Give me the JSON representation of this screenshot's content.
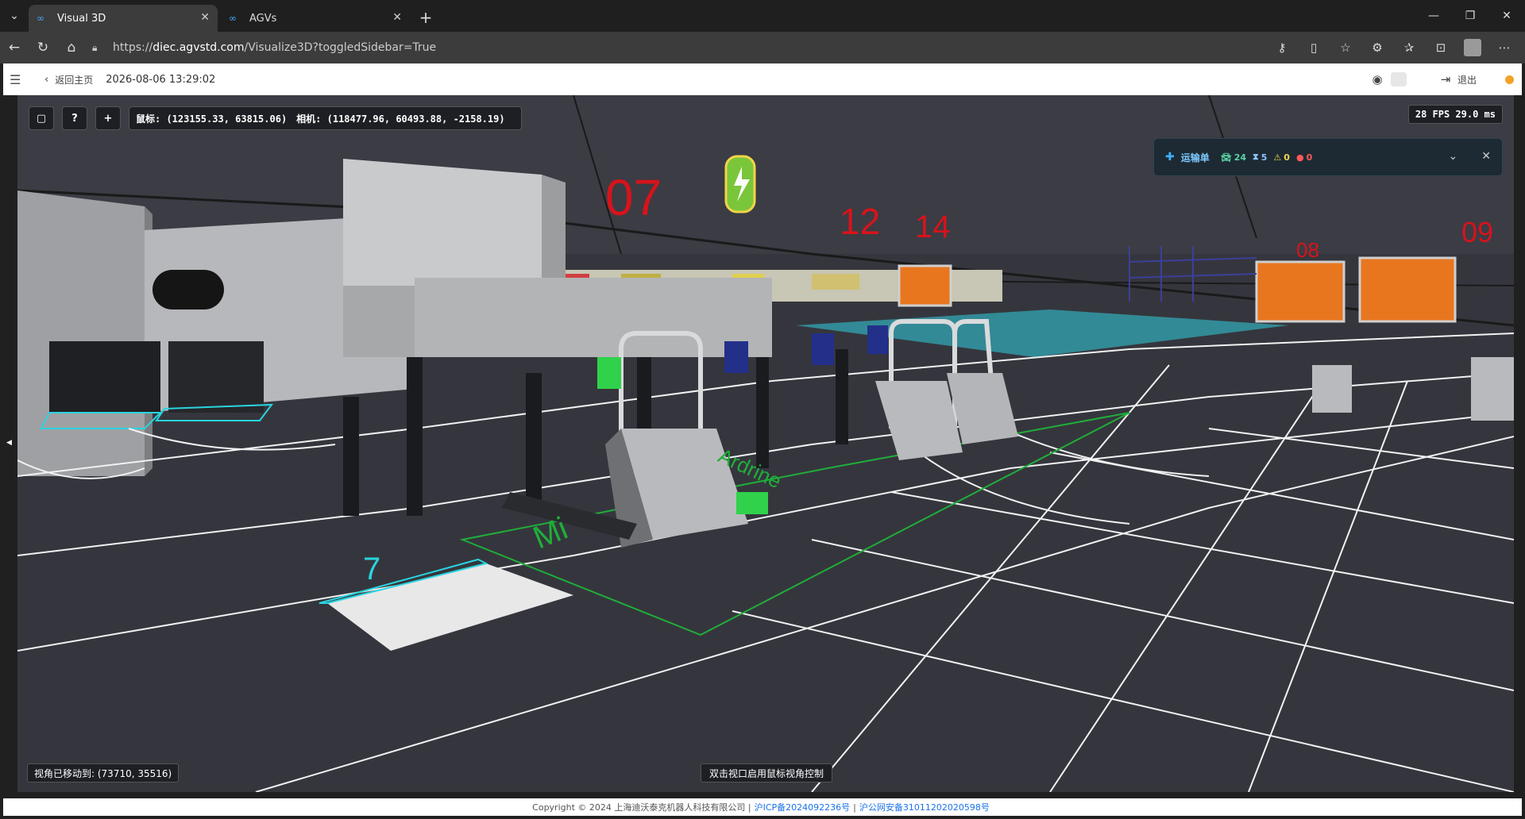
{
  "browser": {
    "tabs": [
      {
        "title": "Visual 3D",
        "active": true
      },
      {
        "title": "AGVs",
        "active": false
      }
    ],
    "url": {
      "scheme": "https://",
      "host": "diec.agvstd.com",
      "path": "/Visualize3D?toggledSidebar=True"
    }
  },
  "header": {
    "back_label": "返回主页",
    "datetime": "2026-08-06 13:29:02",
    "logout_label": "退出"
  },
  "toolbar": {
    "btn1": "▢",
    "btn2": "?",
    "btn3": "+",
    "mouse": "鼠标: (123155.33, 63815.06)",
    "camera": "相机: (118477.96, 60493.88, -2158.19)"
  },
  "fps": "28 FPS 29.0 ms",
  "transport": {
    "label": "运输单",
    "vehicles": "24",
    "waiting": "5",
    "warning": "0",
    "error": "0"
  },
  "scene": {
    "stations": [
      "07",
      "12",
      "14",
      "08",
      "09"
    ],
    "floor_text": "Mi",
    "floor_text2": "Ardrine",
    "zone_mark": "7"
  },
  "status": {
    "moved": "视角已移动到: (73710, 35516)",
    "hint": "双击视口启用鼠标视角控制"
  },
  "footer": {
    "copyright": "Copyright © 2024 上海迪沃泰克机器人科技有限公司 |",
    "icp": "沪ICP备2024092236号",
    "sep": "|",
    "police": "沪公网安备31011202020598号"
  },
  "colors": {
    "accent": "#3fb2ff",
    "station_red": "#d8131b",
    "floor_line": "#ffffff",
    "zone_green": "#1fae3a",
    "gate_orange": "#e8761f"
  }
}
